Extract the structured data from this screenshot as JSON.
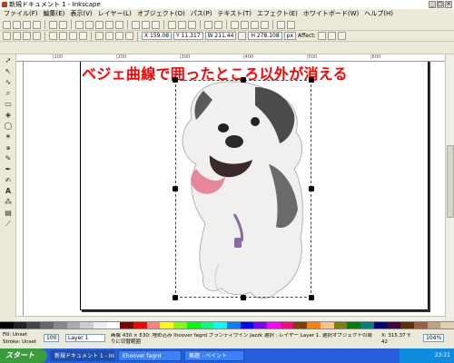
{
  "window": {
    "title": "新規ドキュメント 1 - Inkscape"
  },
  "menubar": [
    "ファイル(F)",
    "編集(E)",
    "表示(V)",
    "レイヤー(L)",
    "オブジェクト(O)",
    "パス(P)",
    "テキスト(T)",
    "エフェクト(E)",
    "ホワイトボード(W)",
    "ヘルプ(H)"
  ],
  "toolbar": {
    "x_field": "X 159.08",
    "y_field": "Y 11.317",
    "w_field": "W 211.44",
    "h_field": "H 278.108",
    "unit": "px",
    "affect_label": "Affect:"
  },
  "ruler": {
    "ticks": [
      "",
      "|100",
      "|200",
      "|300",
      "|400",
      "|500",
      "|600"
    ]
  },
  "canvas": {
    "headline": "ベジェ曲線で囲ったところ以外が消える"
  },
  "palette": [
    "#000000",
    "#222222",
    "#444444",
    "#666666",
    "#888888",
    "#aaaaaa",
    "#cccccc",
    "#eeeeee",
    "#ffffff",
    "#800000",
    "#ff0000",
    "#ff8080",
    "#ffff00",
    "#80ff00",
    "#00ff00",
    "#00ff80",
    "#00ffff",
    "#0080ff",
    "#0000ff",
    "#8000ff",
    "#ff00ff",
    "#ff0080",
    "#804000",
    "#ff8000",
    "#ffc080",
    "#808000",
    "#008000",
    "#008080",
    "#000080",
    "#400040",
    "#603000",
    "#a06040",
    "#c0a080",
    "#e0d0b0"
  ],
  "status": {
    "fill_label": "Fill:",
    "stroke_label": "Stroke:",
    "fill_value": "Unset",
    "stroke_value": "Unset",
    "opacity": "100",
    "layer": "Layer 1",
    "message": "画像 430 × 530: 埋め込み lhoover fagrd ブランディワイン Jazzk 選択 : レイヤー Layer 1. 選択オブジェクトの周りに切替範囲 ",
    "coords": "X: 315.37  Y: 42",
    "zoom": "104%"
  },
  "taskbar": {
    "start": "スタート",
    "tasks": [
      "新規ドキュメント 1 - Inkscape",
      "Ehoover fagrd",
      "無題 - ペイント"
    ],
    "clock": "23:21"
  }
}
